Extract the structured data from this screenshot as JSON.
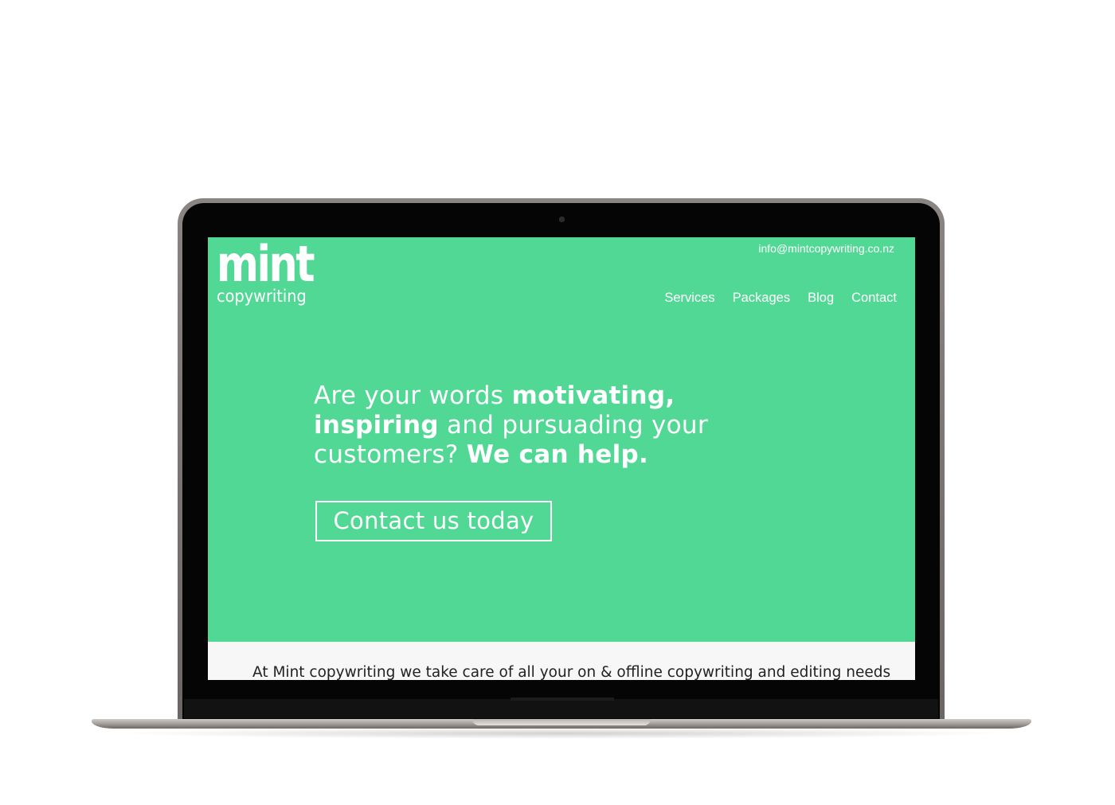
{
  "site": {
    "logo": {
      "primary": "mint",
      "secondary": "copywriting"
    },
    "email": "info@mintcopywriting.co.nz",
    "nav": [
      {
        "label": "Services"
      },
      {
        "label": "Packages"
      },
      {
        "label": "Blog"
      },
      {
        "label": "Contact"
      }
    ],
    "hero": {
      "headline_parts": [
        "Are your words ",
        "motivating,",
        "inspiring",
        " and pursuading your customers? ",
        "We can help."
      ],
      "cta_label": "Contact us today"
    },
    "intro": "At Mint copywriting we take care of all your on & offline copywriting and editing needs"
  },
  "colors": {
    "brand_green": "#52d895",
    "text_on_brand": "#ffffff",
    "intro_bg": "#f7f7f7",
    "intro_text": "#222222"
  }
}
